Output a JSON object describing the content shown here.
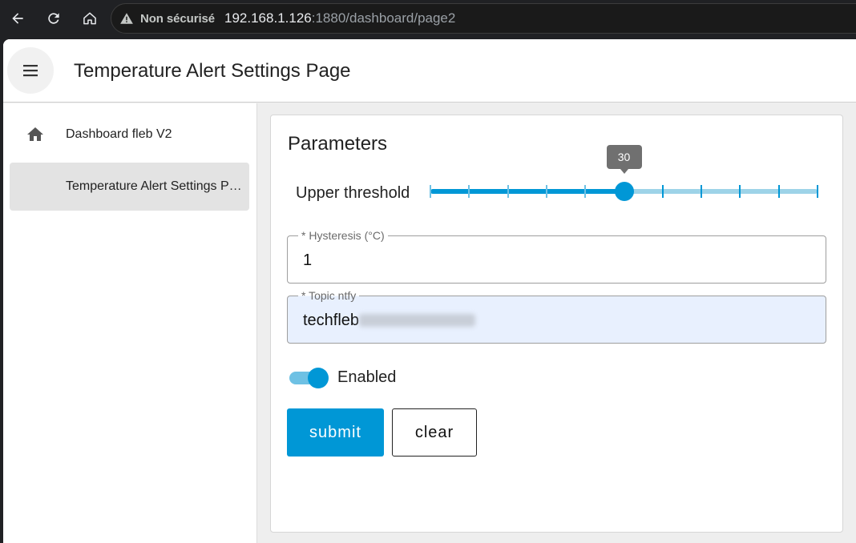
{
  "browser": {
    "security_label": "Non sécurisé",
    "url_host": "192.168.1.126",
    "url_rest": ":1880/dashboard/page2"
  },
  "header": {
    "title": "Temperature Alert Settings Page"
  },
  "sidebar": {
    "items": [
      {
        "label": "Dashboard fleb V2",
        "icon": "home-icon",
        "active": false
      },
      {
        "label": "Temperature Alert Settings Page",
        "icon": "",
        "active": true
      }
    ]
  },
  "form": {
    "title": "Parameters",
    "slider": {
      "label": "Upper threshold",
      "value": "30",
      "fraction": 0.5,
      "ticks": 11
    },
    "hysteresis": {
      "label": "* Hysteresis (°C)",
      "value": "1"
    },
    "topic": {
      "label": "* Topic ntfy",
      "value": "techfleb"
    },
    "toggle": {
      "label": "Enabled",
      "on": true
    },
    "submit_label": "submit",
    "clear_label": "clear"
  },
  "colors": {
    "accent": "#0097d6",
    "track_light": "#9dd3e8"
  }
}
